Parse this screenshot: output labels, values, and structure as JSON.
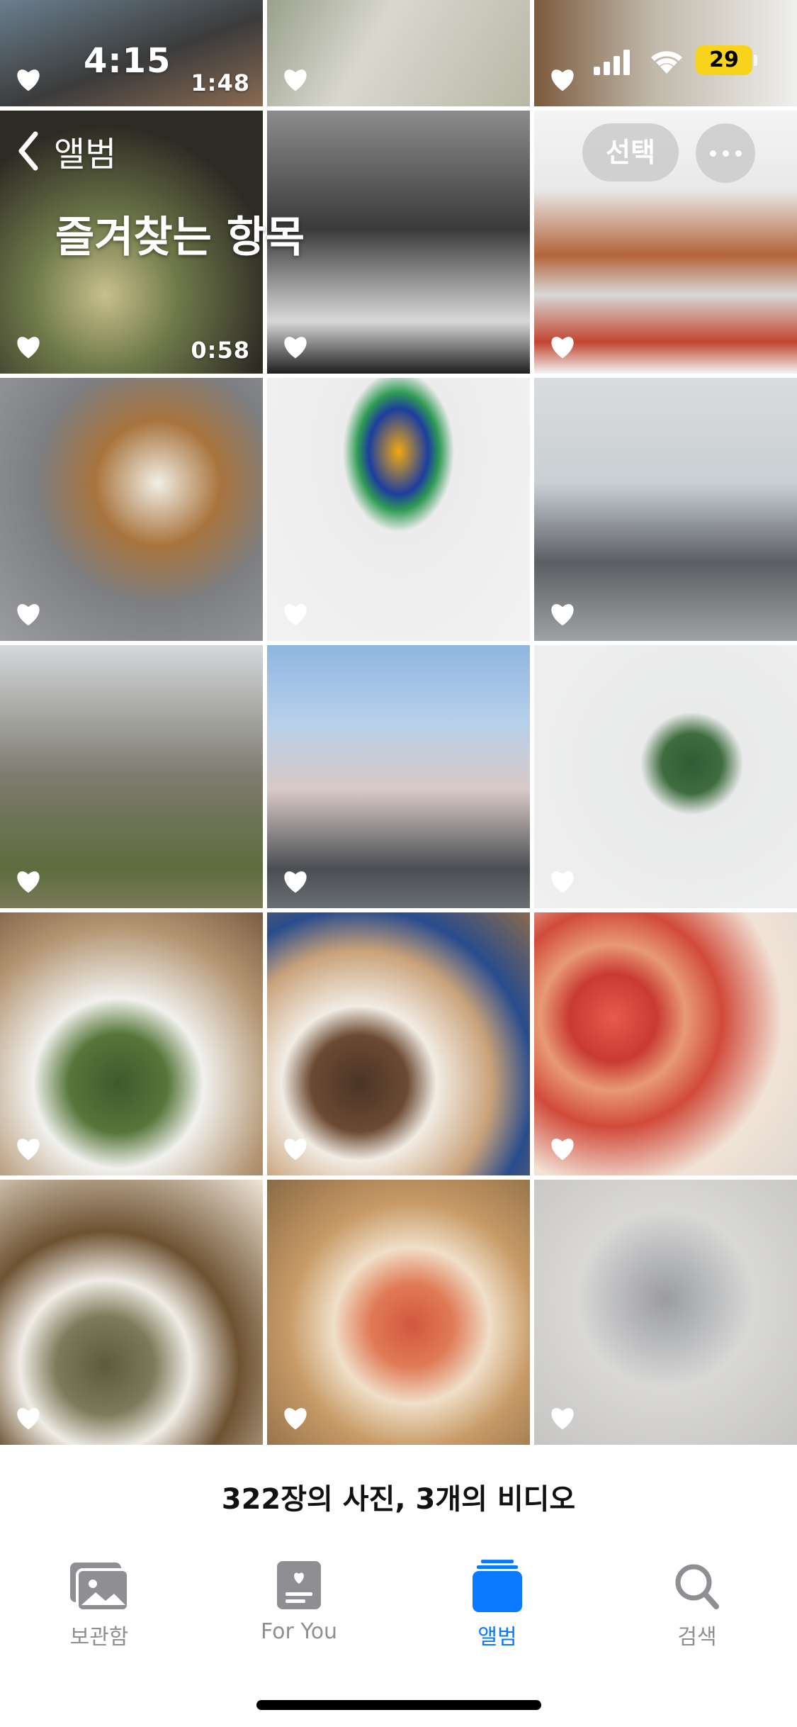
{
  "status_bar": {
    "time": "4:15",
    "battery": "29"
  },
  "nav": {
    "back_label": "앨범",
    "title": "즐겨찾는 항목",
    "select_label": "선택"
  },
  "grid": {
    "video_durations": {
      "top_left": "1:48",
      "row1_left": "0:58"
    }
  },
  "summary": "322장의 사진, 3개의 비디오",
  "tabs": [
    {
      "label": "보관함",
      "icon": "photo-library-icon",
      "active": false
    },
    {
      "label": "For You",
      "icon": "for-you-icon",
      "active": false
    },
    {
      "label": "앨범",
      "icon": "albums-icon",
      "active": true
    },
    {
      "label": "검색",
      "icon": "search-icon",
      "active": false
    }
  ],
  "colors": {
    "accent": "#0a7bfe",
    "inactive": "#8e8e93",
    "battery": "#f8d31c"
  }
}
